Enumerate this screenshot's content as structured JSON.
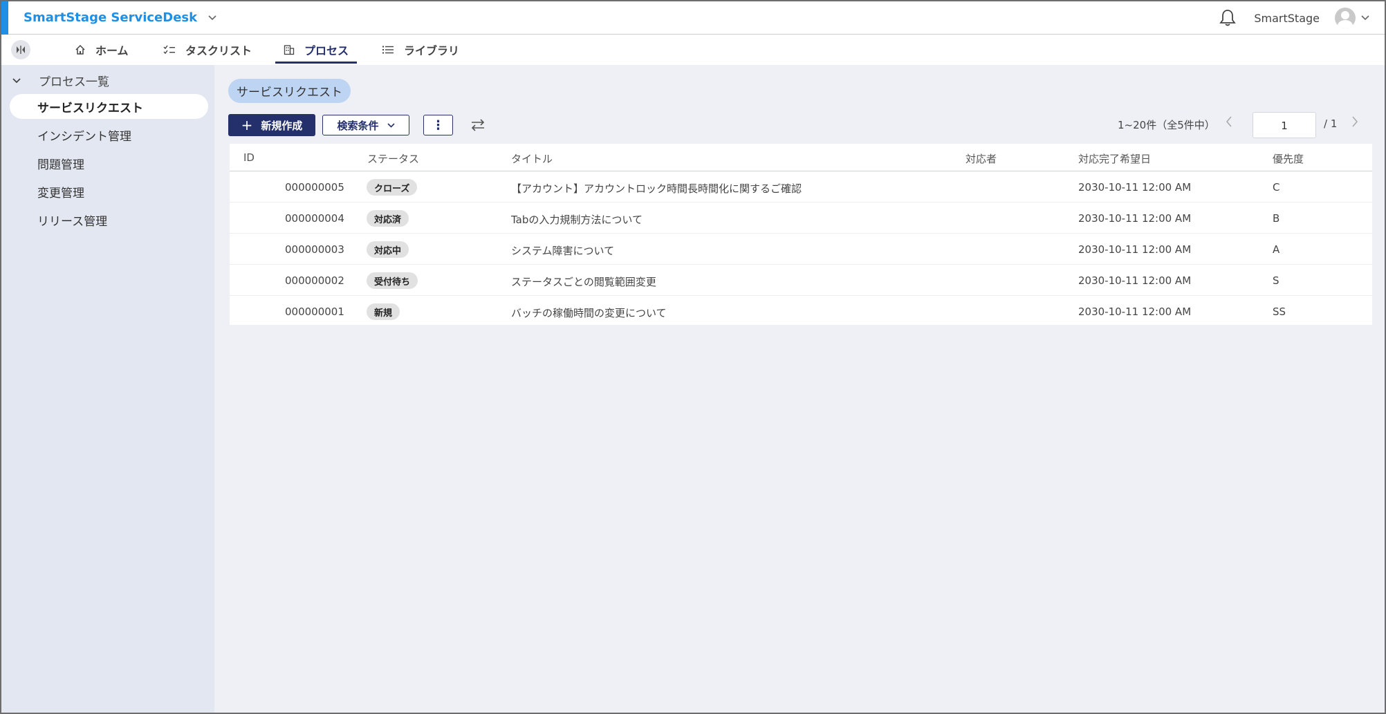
{
  "app": {
    "title": "SmartStage ServiceDesk"
  },
  "header": {
    "user_name": "SmartStage"
  },
  "nav": {
    "tabs": [
      {
        "label": "ホーム",
        "icon": "home-icon"
      },
      {
        "label": "タスクリスト",
        "icon": "checklist-icon"
      },
      {
        "label": "プロセス",
        "icon": "building-icon",
        "active": true
      },
      {
        "label": "ライブラリ",
        "icon": "list-icon"
      }
    ]
  },
  "sidebar": {
    "group_label": "プロセス一覧",
    "items": [
      {
        "label": "サービスリクエスト",
        "active": true
      },
      {
        "label": "インシデント管理"
      },
      {
        "label": "問題管理"
      },
      {
        "label": "変更管理"
      },
      {
        "label": "リリース管理"
      }
    ]
  },
  "main": {
    "chip_label": "サービスリクエスト",
    "toolbar": {
      "new_label": "新規作成",
      "search_label": "検索条件",
      "more_label": "⋮"
    },
    "pager": {
      "range": "1~20件（全5件中）",
      "current_page": "1",
      "total": "/ 1"
    },
    "table": {
      "columns": [
        "ID",
        "ステータス",
        "タイトル",
        "対応者",
        "対応完了希望日",
        "優先度"
      ],
      "rows": [
        {
          "id": "000000005",
          "status": "クローズ",
          "title": "【アカウント】アカウントロック時間長時間化に関するご確認",
          "assignee": "",
          "due": "2030-10-11 12:00 AM",
          "priority": "C"
        },
        {
          "id": "000000004",
          "status": "対応済",
          "title": "Tabの入力規制方法について",
          "assignee": "",
          "due": "2030-10-11 12:00 AM",
          "priority": "B"
        },
        {
          "id": "000000003",
          "status": "対応中",
          "title": "システム障害について",
          "assignee": "",
          "due": "2030-10-11 12:00 AM",
          "priority": "A"
        },
        {
          "id": "000000002",
          "status": "受付待ち",
          "title": "ステータスごとの閲覧範囲変更",
          "assignee": "",
          "due": "2030-10-11 12:00 AM",
          "priority": "S"
        },
        {
          "id": "000000001",
          "status": "新規",
          "title": "バッチの稼働時間の変更について",
          "assignee": "",
          "due": "2030-10-11 12:00 AM",
          "priority": "SS"
        }
      ]
    }
  },
  "colors": {
    "brand": "#1e8fe6",
    "primary": "#23306b",
    "chip": "#bdd4f2",
    "sidebar_bg": "#e3e7f1",
    "page_bg": "#eef0f5"
  }
}
